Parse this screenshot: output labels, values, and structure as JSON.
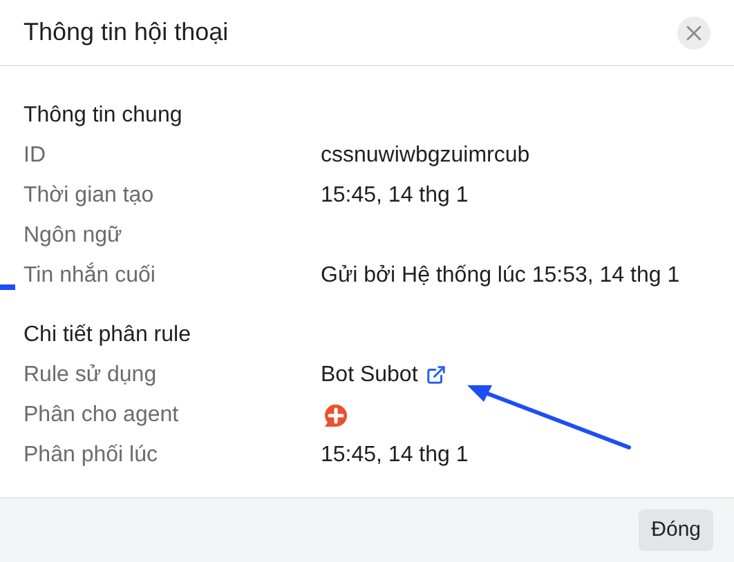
{
  "dialog": {
    "title": "Thông tin hội thoại"
  },
  "sections": [
    {
      "title": "Thông tin chung",
      "rows": [
        {
          "label": "ID",
          "kind": "text",
          "value": "cssnuwiwbgzuimrcub"
        },
        {
          "label": "Thời gian tạo",
          "kind": "text",
          "value": "15:45, 14 thg 1"
        },
        {
          "label": "Ngôn ngữ",
          "kind": "empty"
        },
        {
          "label": "Tin nhắn cuối",
          "kind": "text",
          "value": "Gửi bởi Hệ thống lúc 15:53, 14 thg 1"
        }
      ]
    },
    {
      "title": "Chi tiết phân rule",
      "rows": [
        {
          "label": "Rule sử dụng",
          "kind": "link",
          "value": "Bot Subot"
        },
        {
          "label": "Phân cho agent",
          "kind": "avatar"
        },
        {
          "label": "Phân phối lúc",
          "kind": "text",
          "value": "15:45, 14 thg 1"
        }
      ]
    }
  ],
  "footer": {
    "button": "Đóng"
  }
}
